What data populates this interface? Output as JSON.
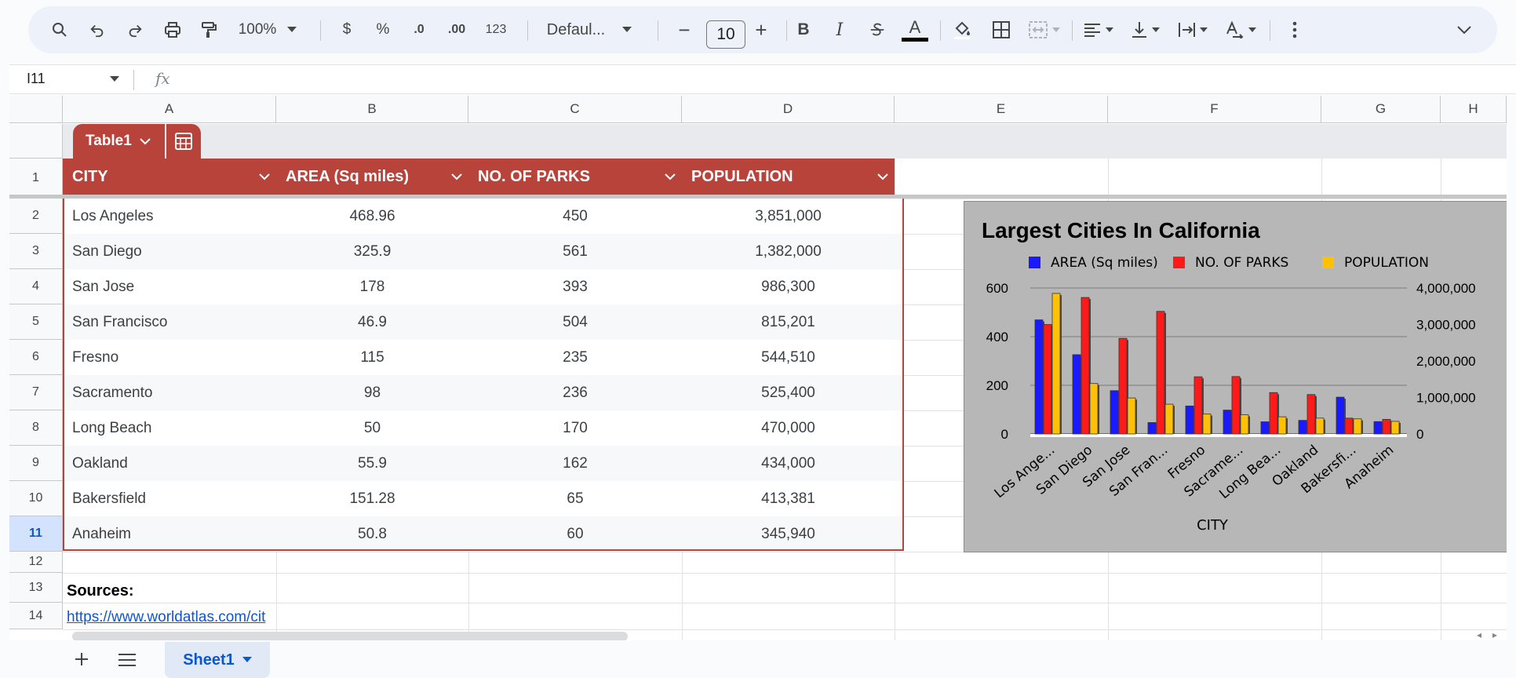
{
  "toolbar": {
    "zoom": "100%",
    "currency": "$",
    "percent": "%",
    "dec_decrease": ".0",
    "dec_increase": ".00",
    "num_format": "123",
    "font": "Defaul...",
    "font_size": "10",
    "minus": "−",
    "plus": "+",
    "bold": "B",
    "italic": "I",
    "text_color": "A"
  },
  "formula_bar": {
    "name_box": "I11",
    "fx": "fx",
    "value": ""
  },
  "columns": [
    "A",
    "B",
    "C",
    "D",
    "E",
    "F",
    "G",
    "H"
  ],
  "rows": [
    "1",
    "2",
    "3",
    "4",
    "5",
    "6",
    "7",
    "8",
    "9",
    "10",
    "11",
    "12",
    "13",
    "14"
  ],
  "selected_row": "11",
  "table": {
    "name": "Table1",
    "headers": [
      "CITY",
      "AREA (Sq miles)",
      "NO. OF PARKS",
      "POPULATION"
    ],
    "rows": [
      [
        "Los Angeles",
        "468.96",
        "450",
        "3,851,000"
      ],
      [
        "San Diego",
        "325.9",
        "561",
        "1,382,000"
      ],
      [
        "San Jose",
        "178",
        "393",
        "986,300"
      ],
      [
        "San Francisco",
        "46.9",
        "504",
        "815,201"
      ],
      [
        "Fresno",
        "115",
        "235",
        "544,510"
      ],
      [
        "Sacramento",
        "98",
        "236",
        "525,400"
      ],
      [
        "Long Beach",
        "50",
        "170",
        "470,000"
      ],
      [
        "Oakland",
        "55.9",
        "162",
        "434,000"
      ],
      [
        "Bakersfield",
        "151.28",
        "65",
        "413,381"
      ],
      [
        "Anaheim",
        "50.8",
        "60",
        "345,940"
      ]
    ],
    "header_color": "#b8433b"
  },
  "sources_label": "Sources:",
  "sources_link": "https://www.worldatlas.com/cit",
  "sheet_tab": "Sheet1",
  "chart_data": {
    "type": "bar",
    "title": "Largest Cities In California",
    "xlabel": "CITY",
    "categories": [
      "Los Ange...",
      "San Diego",
      "San Jose",
      "San Fran...",
      "Fresno",
      "Sacrame...",
      "Long Bea...",
      "Oakland",
      "Bakersfi...",
      "Anaheim"
    ],
    "series": [
      {
        "name": "AREA (Sq miles)",
        "color": "#1a1aff",
        "axis": "left",
        "values": [
          468.96,
          325.9,
          178,
          46.9,
          115,
          98,
          50,
          55.9,
          151.28,
          50.8
        ]
      },
      {
        "name": "NO. OF PARKS",
        "color": "#ff1a1a",
        "axis": "left",
        "values": [
          450,
          561,
          393,
          504,
          235,
          236,
          170,
          162,
          65,
          60
        ]
      },
      {
        "name": "POPULATION",
        "color": "#ffc107",
        "axis": "right",
        "values": [
          3851000,
          1382000,
          986300,
          815201,
          544510,
          525400,
          470000,
          434000,
          413381,
          345940
        ]
      }
    ],
    "left_axis": {
      "ticks": [
        "0",
        "200",
        "400",
        "600"
      ],
      "ylim": [
        0,
        600
      ]
    },
    "right_axis": {
      "ticks": [
        "0",
        "1,000,000",
        "2,000,000",
        "3,000,000",
        "4,000,000"
      ],
      "ylim": [
        0,
        4000000
      ]
    },
    "legend": "top",
    "grid": true
  }
}
